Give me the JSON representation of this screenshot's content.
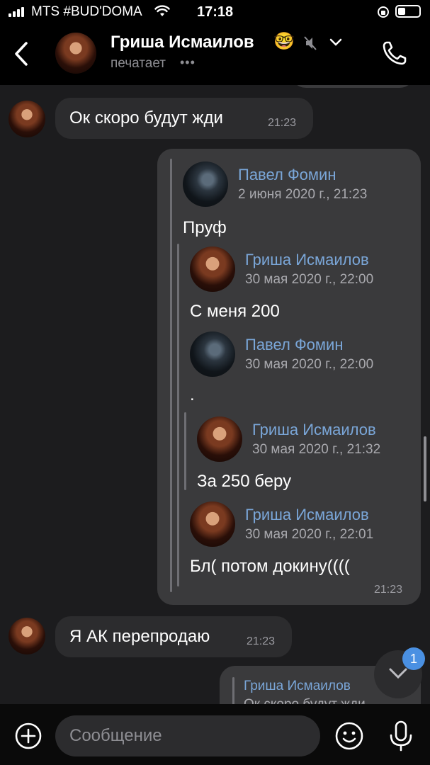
{
  "status_bar": {
    "carrier": "MTS #BUD'DOMA",
    "time": "17:18"
  },
  "header": {
    "contact_name": "Гриша Исмаилов",
    "emoji": "🤓",
    "status": "печатает"
  },
  "messages": [
    {
      "text": "Ок скоро будут жди",
      "time": "21:23"
    },
    {
      "text": "Я АК перепродаю",
      "time": "21:23"
    }
  ],
  "forwarded": {
    "time": "21:23",
    "items": [
      {
        "name": "Павел Фомин",
        "date": "2 июня 2020 г., 21:23",
        "text": "Пруф"
      },
      {
        "name": "Гриша Исмаилов",
        "date": "30 мая 2020 г., 22:00",
        "text": "С меня 200"
      },
      {
        "name": "Павел Фомин",
        "date": "30 мая 2020 г., 22:00",
        "text": "."
      },
      {
        "name": "Гриша Исмаилов",
        "date": "30 мая 2020 г., 21:32",
        "text": "За 250 беру"
      },
      {
        "name": "Гриша Исмаилов",
        "date": "30 мая 2020 г., 22:01",
        "text": "Бл( потом докину(((("
      }
    ]
  },
  "outgoing_reply": {
    "name": "Гриша Исмаилов",
    "preview": "Ок скоро будут жди"
  },
  "scroll_badge": "1",
  "input": {
    "placeholder": "Сообщение"
  },
  "colors": {
    "background": "#000000",
    "bubble": "#2c2c2e",
    "name_link": "#7aa6d8",
    "badge": "#4a90e2"
  }
}
